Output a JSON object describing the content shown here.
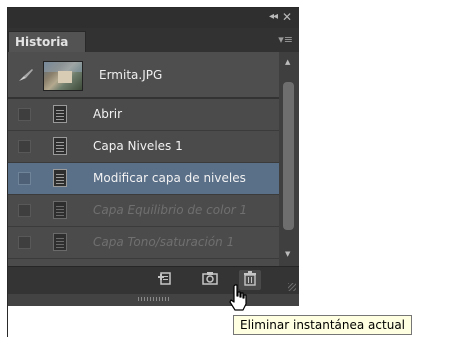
{
  "titlebar": {
    "collapse_glyph": "◂◂",
    "close_glyph": "✕"
  },
  "tab": {
    "label": "Historia",
    "menu_icon": "panel-menu-icon"
  },
  "snapshot": {
    "name": "Ermita.JPG"
  },
  "history": [
    {
      "label": "Abrir",
      "state": "normal"
    },
    {
      "label": "Capa Niveles 1",
      "state": "normal"
    },
    {
      "label": "Modificar capa de niveles",
      "state": "selected"
    },
    {
      "label": "Capa Equilibrio de color 1",
      "state": "dimmed"
    },
    {
      "label": "Capa Tono/saturación 1",
      "state": "dimmed"
    }
  ],
  "toolbar": {
    "new_document_icon": "new-document-from-state-icon",
    "snapshot_icon": "camera-icon",
    "delete_icon": "trash-icon"
  },
  "tooltip": {
    "text": "Eliminar instantánea actual"
  },
  "colors": {
    "panel": "#434343",
    "selected": "#5a6f88",
    "tooltip_bg": "#ffffe1"
  }
}
